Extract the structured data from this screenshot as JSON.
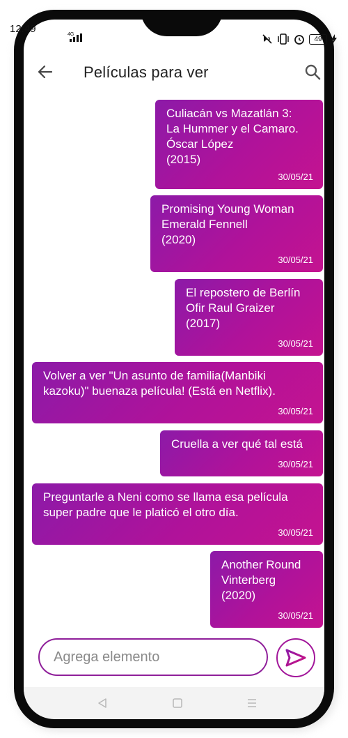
{
  "status_bar": {
    "time": "12:49",
    "network": "4G",
    "battery": "49"
  },
  "header": {
    "title": "Películas para ver"
  },
  "messages": [
    {
      "text": "Culiacán vs Mazatlán 3:\nLa Hummer y el Camaro.\nÓscar López\n(2015)",
      "date": "30/05/21"
    },
    {
      "text": "Promising Young Woman\nEmerald Fennell\n(2020)",
      "date": "30/05/21"
    },
    {
      "text": "El repostero de Berlín\nOfir Raul Graizer\n(2017)",
      "date": "30/05/21"
    },
    {
      "text": "Volver a ver \"Un asunto de familia(Manbiki\nkazoku)\" buenaza película! (Está en Netflix).",
      "date": "30/05/21"
    },
    {
      "text": "Cruella a ver qué tal está",
      "date": "30/05/21"
    },
    {
      "text": "Preguntarle a Neni como se llama esa película\nsuper padre que le platicó el otro día.",
      "date": "30/05/21"
    },
    {
      "text": "Another Round\nVinterberg\n(2020)",
      "date": "30/05/21"
    }
  ],
  "composer": {
    "placeholder": "Agrega elemento",
    "value": ""
  },
  "icons": {
    "back": "arrow-left-icon",
    "search": "search-icon",
    "send": "send-icon",
    "nav_back": "triangle-back-icon",
    "nav_home": "square-home-icon",
    "nav_menu": "menu-lines-icon"
  },
  "colors": {
    "bubble_start": "#8c1aa8",
    "bubble_end": "#c41390",
    "accent": "#a2169a"
  }
}
